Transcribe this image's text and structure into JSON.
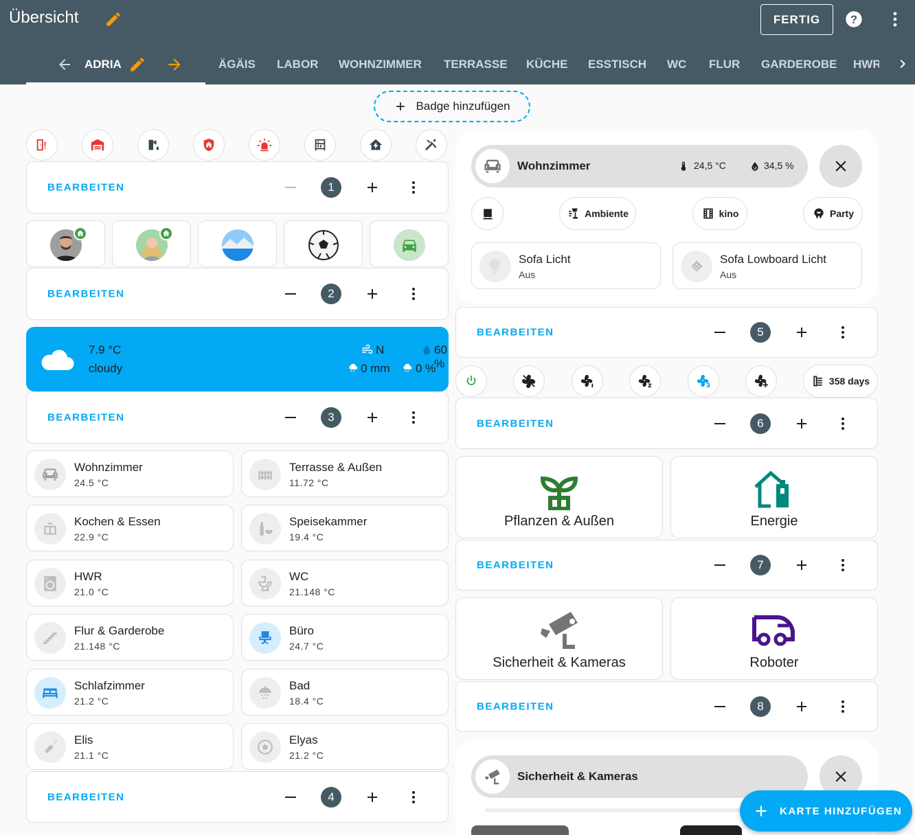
{
  "header": {
    "title": "Übersicht",
    "done_label": "FERTIG",
    "tabs": [
      {
        "label": "ADRIA",
        "active": true
      },
      {
        "label": "ÄGÄIS"
      },
      {
        "label": "LABOR"
      },
      {
        "label": "WOHNZIMMER"
      },
      {
        "label": "TERRASSE"
      },
      {
        "label": "KÜCHE"
      },
      {
        "label": "ESSTISCH"
      },
      {
        "label": "WC"
      },
      {
        "label": "FLUR"
      },
      {
        "label": "GARDEROBE"
      },
      {
        "label": "HWR"
      }
    ]
  },
  "badge_add_label": "Badge hinzufügen",
  "edit_label": "BEARBEITEN",
  "edit_bars": [
    "1",
    "2",
    "3",
    "4",
    "5",
    "6",
    "7",
    "8"
  ],
  "top_buttons": [
    "door-alert-icon",
    "garage-icon",
    "water-pump-icon",
    "shield-home-icon",
    "alarm-light-icon",
    "library-shelves-icon",
    "home-lightning-icon",
    "tools-icon"
  ],
  "persons": [
    {
      "name": "person-1",
      "home": true
    },
    {
      "name": "person-2",
      "home": true
    },
    {
      "name": "landscape"
    },
    {
      "name": "soccer-ball"
    },
    {
      "name": "car"
    }
  ],
  "weather": {
    "temperature": "7.9 °C",
    "condition": "cloudy",
    "wind": "N",
    "humidity": "60 %",
    "precipitation": "0 mm",
    "precipitation_probability": "0 %"
  },
  "rooms": [
    {
      "name": "Wohnzimmer",
      "temp": "24.5 °C",
      "icon": "sofa-icon"
    },
    {
      "name": "Terrasse & Außen",
      "temp": "11.72 °C",
      "icon": "fence-icon"
    },
    {
      "name": "Kochen & Essen",
      "temp": "22.9 °C",
      "icon": "kitchen-icon"
    },
    {
      "name": "Speisekammer",
      "temp": "19.4 °C",
      "icon": "bottle-bowl-icon"
    },
    {
      "name": "HWR",
      "temp": "21.0 °C",
      "icon": "washing-machine-icon"
    },
    {
      "name": "WC",
      "temp": "21.148 °C",
      "icon": "toilet-icon"
    },
    {
      "name": "Flur & Garderobe",
      "temp": "21.148 °C",
      "icon": "stairs-icon"
    },
    {
      "name": "Büro",
      "temp": "24.7 °C",
      "icon": "desk-chair-icon",
      "active": true
    },
    {
      "name": "Schlafzimmer",
      "temp": "21.2 °C",
      "icon": "bed-icon",
      "active": true
    },
    {
      "name": "Bad",
      "temp": "18.4 °C",
      "icon": "shower-icon"
    },
    {
      "name": "Elis",
      "temp": "21.1 °C",
      "icon": "guitar-icon"
    },
    {
      "name": "Elyas",
      "temp": "21.2 °C",
      "icon": "soccer-icon"
    }
  ],
  "area": {
    "name": "Wohnzimmer",
    "temperature": "24,5 °C",
    "humidity": "34,5 %",
    "chips": [
      {
        "label": "",
        "icon": "speaker-icon"
      },
      {
        "label": "Ambiente",
        "icon": "lamp-icon"
      },
      {
        "label": "kino",
        "icon": "film-icon"
      },
      {
        "label": "Party",
        "icon": "party-icon"
      }
    ],
    "lights": [
      {
        "name": "Sofa Licht",
        "state": "Aus",
        "icon": "bulb-icon"
      },
      {
        "name": "Sofa Lowboard Licht",
        "state": "Aus",
        "icon": "led-strip-icon"
      }
    ]
  },
  "fan_buttons": [
    "power-icon",
    "fan-off-icon",
    "fan-speed-1-icon",
    "fan-speed-2-icon",
    "fan-speed-3-icon",
    "fan-plus-icon"
  ],
  "fan_duration": "358 days",
  "tiles": [
    {
      "label": "Pflanzen & Außen",
      "color": "#2e7d32",
      "icon": "sprout-icon"
    },
    {
      "label": "Energie",
      "color": "#00897b",
      "icon": "home-battery-icon"
    },
    {
      "label": "Sicherheit & Kameras",
      "color": "#757575",
      "icon": "cctv-icon"
    },
    {
      "label": "Roboter",
      "color": "#4a148c",
      "icon": "robot-vacuum-icon"
    }
  ],
  "security_area": {
    "name": "Sicherheit & Kameras"
  },
  "fab_label": "KARTE HINZUFÜGEN",
  "colors": {
    "header": "#455a64",
    "accent": "#03a9f4",
    "edit_pencil": "#ff9800"
  }
}
